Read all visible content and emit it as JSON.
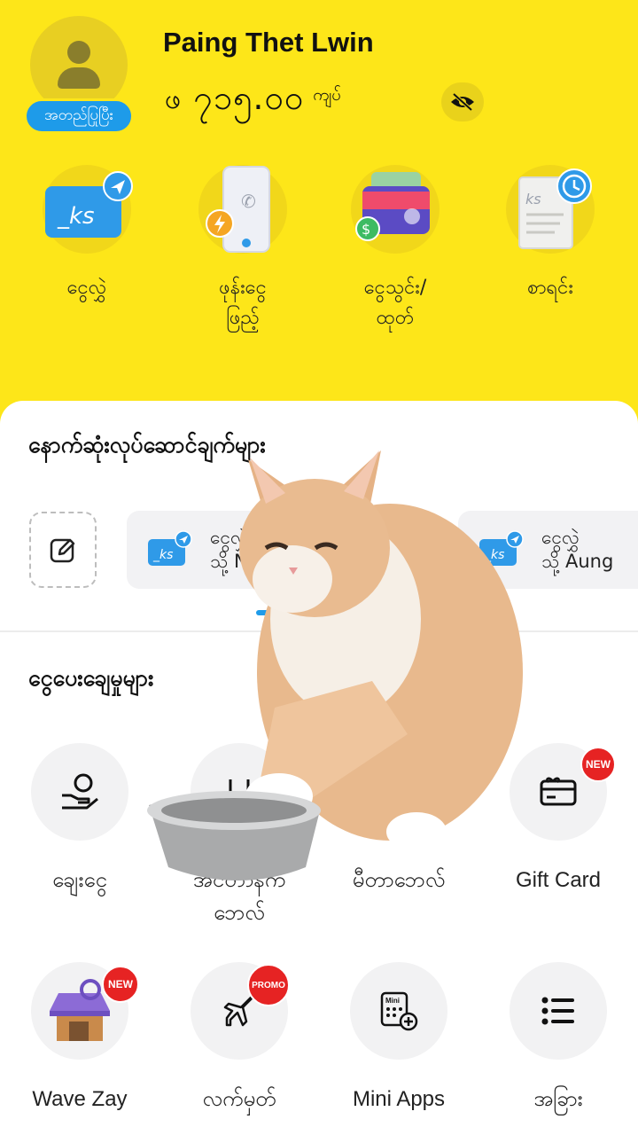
{
  "header": {
    "user_name": "Paing Thet Lwin",
    "verify_label": "အတည်ပြုပြီး",
    "currency_symbol": "ဖ",
    "balance_amount": "၇၁၅.၀၀",
    "balance_unit": "ကျပ်",
    "icons": {
      "avatar": "person-icon",
      "toggle": "eye-slash-icon"
    }
  },
  "quick_actions": [
    {
      "label_line1": "ငွေလွှဲ",
      "label_line2": "",
      "icon": "ks-send-icon"
    },
    {
      "label_line1": "ဖုန်းငွေ",
      "label_line2": "ဖြည့်",
      "icon": "phone-topup-icon"
    },
    {
      "label_line1": "ငွေသွင်း/",
      "label_line2": "ထုတ်",
      "icon": "wallet-icon"
    },
    {
      "label_line1": "စာရင်း",
      "label_line2": "",
      "icon": "history-icon"
    }
  ],
  "recent": {
    "title": "နောက်ဆုံးလုပ်ဆောင်ချက်များ",
    "items": [
      {
        "line1": "ငွေလွှဲ",
        "line2": "သို့ N"
      },
      {
        "line1": "ငွေလွှဲ",
        "line2": "သို့ Aung"
      }
    ]
  },
  "services": {
    "title": "ငွေပေးချေမှုများ",
    "items": [
      {
        "label_line1": "ချေးငွေ",
        "label_line2": "",
        "icon": "loan-hand-icon",
        "badge": ""
      },
      {
        "label_line1": "အင်တာနက်",
        "label_line2": "ဘေလ်",
        "icon": "router-icon",
        "badge": ""
      },
      {
        "label_line1": "မီတာဘေလ်",
        "label_line2": "",
        "icon": "meter-icon",
        "badge": ""
      },
      {
        "label_line1": "Gift Card",
        "label_line2": "",
        "icon": "gift-card-icon",
        "badge": "NEW"
      },
      {
        "label_line1": "Wave Zay",
        "label_line2": "",
        "icon": "shop-icon",
        "badge": "NEW"
      },
      {
        "label_line1": "လက်မှတ်",
        "label_line2": "",
        "icon": "airplane-icon",
        "badge": "PROMO"
      },
      {
        "label_line1": "Mini Apps",
        "label_line2": "",
        "icon": "mini-apps-icon",
        "badge": ""
      },
      {
        "label_line1": "အခြား",
        "label_line2": "",
        "icon": "list-icon",
        "badge": ""
      }
    ]
  },
  "colors": {
    "brand_yellow": "#fde619",
    "accent_blue": "#1e9be9",
    "badge_red": "#e62323"
  }
}
